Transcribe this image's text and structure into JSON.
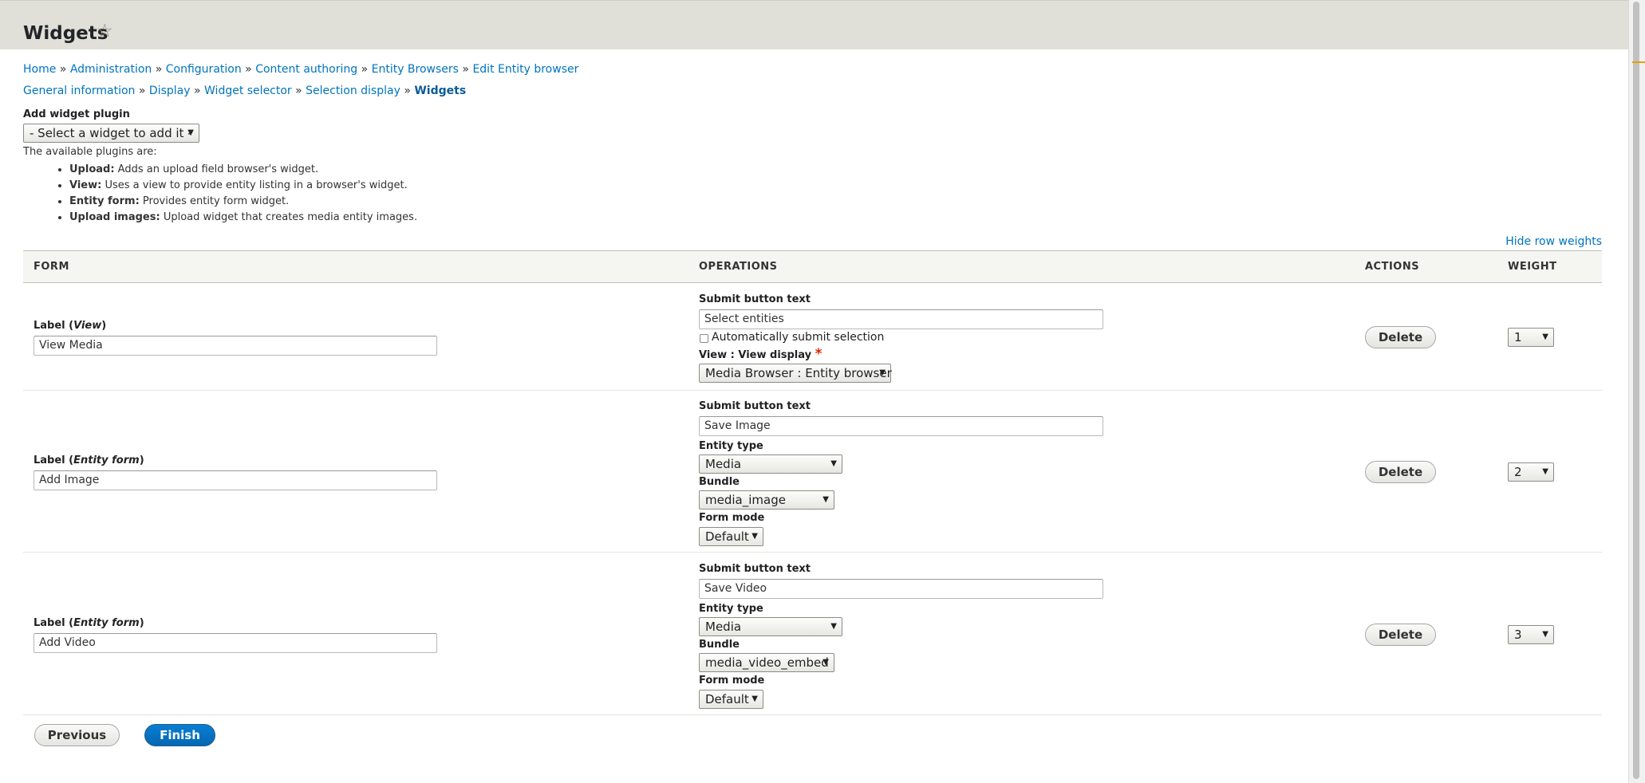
{
  "header": {
    "title": "Widgets",
    "star_icon": "star-outline-icon"
  },
  "breadcrumb": [
    {
      "label": "Home"
    },
    {
      "label": "Administration"
    },
    {
      "label": "Configuration"
    },
    {
      "label": "Content authoring"
    },
    {
      "label": "Entity Browsers"
    },
    {
      "label": "Edit Entity browser"
    }
  ],
  "wizard_steps": [
    {
      "label": "General information"
    },
    {
      "label": "Display"
    },
    {
      "label": "Widget selector"
    },
    {
      "label": "Selection display"
    },
    {
      "label": "Widgets"
    }
  ],
  "breadcrumb_separator": "»",
  "add_widget": {
    "label": "Add widget plugin",
    "select_value": "- Select a widget to add it -",
    "description": "The available plugins are:",
    "plugins": [
      {
        "name": "Upload:",
        "desc": "Adds an upload field browser's widget."
      },
      {
        "name": "View:",
        "desc": "Uses a view to provide entity listing in a browser's widget."
      },
      {
        "name": "Entity form:",
        "desc": "Provides entity form widget."
      },
      {
        "name": "Upload images:",
        "desc": "Upload widget that creates media entity images."
      }
    ]
  },
  "hide_row_weights": "Hide row weights",
  "table": {
    "headers": {
      "form": "FORM",
      "operations": "OPERATIONS",
      "actions": "ACTIONS",
      "weight": "WEIGHT"
    },
    "rows": [
      {
        "label_prefix": "Label (",
        "label_type": "View",
        "label_suffix": ")",
        "label_value": "View Media",
        "submit_label": "Submit button text",
        "submit_value": "Select entities",
        "auto_submit_label": "Automatically submit selection",
        "view_display_label": "View : View display",
        "required_mark": "*",
        "view_display_value": "Media Browser : Entity browser",
        "delete_label": "Delete",
        "weight": "1"
      },
      {
        "label_prefix": "Label (",
        "label_type": "Entity form",
        "label_suffix": ")",
        "label_value": "Add Image",
        "submit_label": "Submit button text",
        "submit_value": "Save Image",
        "entity_type_label": "Entity type",
        "entity_type_value": "Media",
        "bundle_label": "Bundle",
        "bundle_value": "media_image",
        "form_mode_label": "Form mode",
        "form_mode_value": "Default",
        "delete_label": "Delete",
        "weight": "2"
      },
      {
        "label_prefix": "Label (",
        "label_type": "Entity form",
        "label_suffix": ")",
        "label_value": "Add Video",
        "submit_label": "Submit button text",
        "submit_value": "Save Video",
        "entity_type_label": "Entity type",
        "entity_type_value": "Media",
        "bundle_label": "Bundle",
        "bundle_value": "media_video_embed",
        "form_mode_label": "Form mode",
        "form_mode_value": "Default",
        "delete_label": "Delete",
        "weight": "3"
      }
    ]
  },
  "buttons": {
    "previous": "Previous",
    "finish": "Finish"
  },
  "colors": {
    "link": "#0074bd",
    "primary": "#0071b8",
    "header_bg": "#e0e0d8",
    "required": "#e32700"
  }
}
